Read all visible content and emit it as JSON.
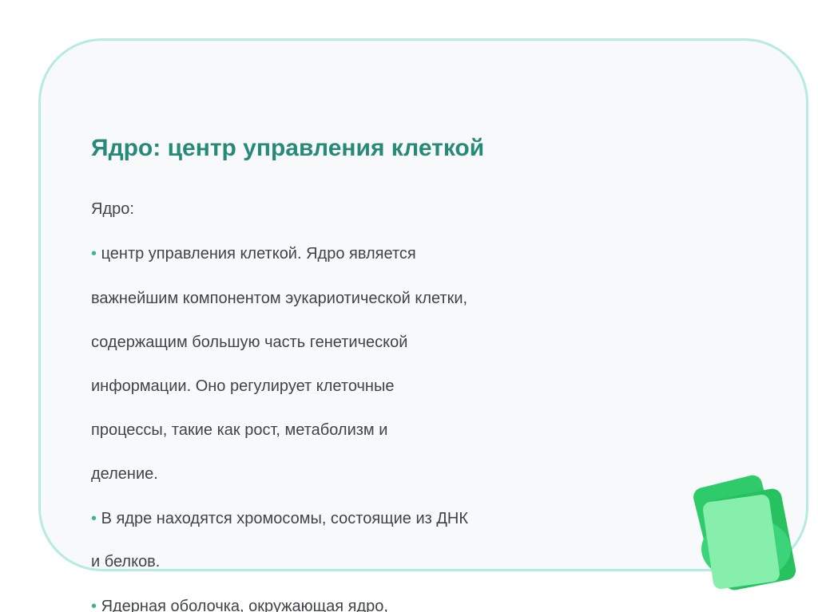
{
  "slide": {
    "title": "Ядро: центр управления клеткой",
    "lines": [
      {
        "bullet": "",
        "text": "Ядро:"
      },
      {
        "bullet": "•",
        "text": " центр управления клеткой. Ядро является"
      },
      {
        "bullet": "",
        "text": "важнейшим компонентом эукариотической клетки,"
      },
      {
        "bullet": "",
        "text": "содержащим большую часть генетической"
      },
      {
        "bullet": "",
        "text": "информации. Оно регулирует клеточные"
      },
      {
        "bullet": "",
        "text": "процессы, такие как рост, метаболизм и"
      },
      {
        "bullet": "",
        "text": "деление."
      },
      {
        "bullet": "•",
        "text": " В ядре находятся хромосомы, состоящие из ДНК"
      },
      {
        "bullet": "",
        "text": "и белков."
      },
      {
        "bullet": "•",
        "text": " Ядерная оболочка, окружающая ядро,"
      }
    ]
  },
  "colors": {
    "title": "#278a79",
    "text": "#404448",
    "bullet": "#3fb58f",
    "panel_border": "#b5ebe0",
    "panel_fill": "#f8f9fa",
    "card_dark": "#2fcb6a",
    "card_mid": "#3bd47a",
    "card_light": "#86efab"
  },
  "decoration": {
    "icon": "green-cards-icon"
  }
}
